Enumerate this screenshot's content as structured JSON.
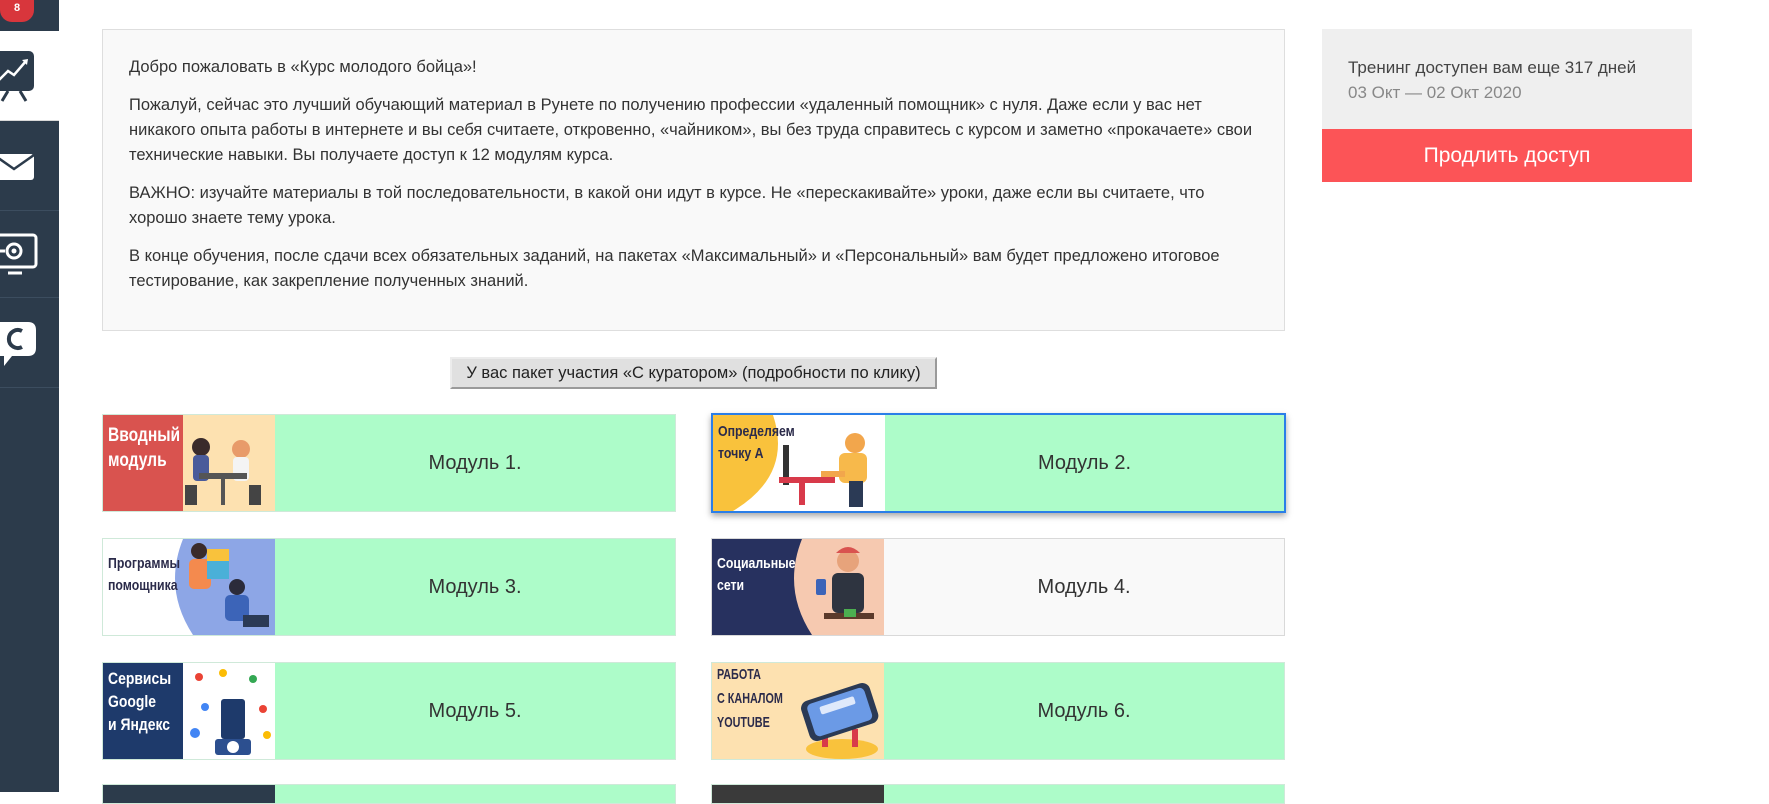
{
  "sidebar": {
    "badge_count": "8",
    "items": [
      {
        "icon": "chart-icon",
        "active": true
      },
      {
        "icon": "mail-icon",
        "active": false
      },
      {
        "icon": "settings-screen-icon",
        "active": false
      },
      {
        "icon": "chat-c-icon",
        "active": false
      }
    ]
  },
  "intro": {
    "p1": "Добро пожаловать в «Курс молодого бойца»!",
    "p2": "Пожалуй, сейчас это лучший обучающий материал в Рунете по получению профессии «удаленный помощник» с нуля. Даже если у вас нет никакого опыта работы в интернете и вы себя считаете, откровенно, «чайником», вы без труда справитесь с курсом и заметно «прокачаете» свои технические навыки. Вы получаете доступ к 12 модулям курса.",
    "p3": "ВАЖНО: изучайте материалы в той последовательности, в какой они идут в курсе. Не «перескакивайте» уроки, даже если вы считаете, что хорошо знаете тему урока.",
    "p4": "В конце обучения, после сдачи всех обязательных заданий, на пакетах «Максимальный» и «Персональный» вам будет предложено итоговое тестирование, как закрепление полученных знаний."
  },
  "package_button": "У вас пакет участия «С куратором» (подробности по клику)",
  "training": {
    "days_text": "Тренинг доступен вам еще 317 дней",
    "dates_text": "03 Окт — 02 Окт 2020",
    "extend_label": "Продлить доступ"
  },
  "colors": {
    "sidebar": "#2c3b4b",
    "module_done": "#adfcc9",
    "module_pending": "#f9f9f9",
    "accent_red": "#fc5457",
    "selected_border": "#2a7ee8"
  },
  "modules": [
    {
      "label": "Модуль 1.",
      "thumb_title_1": "Вводный",
      "thumb_title_2": "модуль",
      "thumb_title_3": "",
      "status": "done"
    },
    {
      "label": "Модуль 2.",
      "thumb_title_1": "Определяем",
      "thumb_title_2": "точку А",
      "thumb_title_3": "",
      "status": "done",
      "selected": true
    },
    {
      "label": "Модуль 3.",
      "thumb_title_1": "Программы",
      "thumb_title_2": "помощника",
      "thumb_title_3": "",
      "status": "done"
    },
    {
      "label": "Модуль 4.",
      "thumb_title_1": "Социальные",
      "thumb_title_2": "сети",
      "thumb_title_3": "",
      "status": "pending"
    },
    {
      "label": "Модуль 5.",
      "thumb_title_1": "Сервисы",
      "thumb_title_2": "Google",
      "thumb_title_3": "и Яндекс",
      "status": "done"
    },
    {
      "label": "Модуль 6.",
      "thumb_title_1": "РАБОТА",
      "thumb_title_2": "С КАНАЛОМ",
      "thumb_title_3": "YOUTUBE",
      "status": "done"
    }
  ]
}
